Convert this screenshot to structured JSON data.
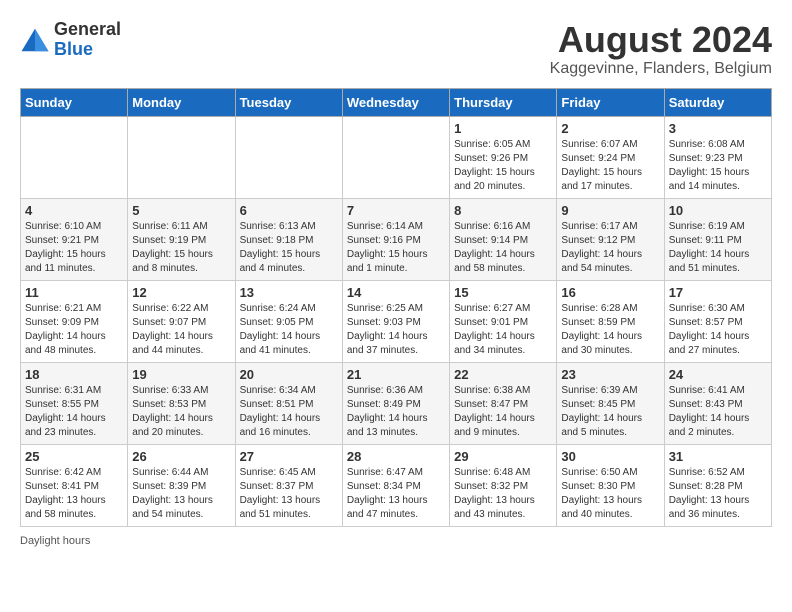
{
  "logo": {
    "general": "General",
    "blue": "Blue"
  },
  "title": "August 2024",
  "location": "Kaggevinne, Flanders, Belgium",
  "days_of_week": [
    "Sunday",
    "Monday",
    "Tuesday",
    "Wednesday",
    "Thursday",
    "Friday",
    "Saturday"
  ],
  "footer": "Daylight hours",
  "weeks": [
    [
      {
        "day": "",
        "detail": ""
      },
      {
        "day": "",
        "detail": ""
      },
      {
        "day": "",
        "detail": ""
      },
      {
        "day": "",
        "detail": ""
      },
      {
        "day": "1",
        "detail": "Sunrise: 6:05 AM\nSunset: 9:26 PM\nDaylight: 15 hours\nand 20 minutes."
      },
      {
        "day": "2",
        "detail": "Sunrise: 6:07 AM\nSunset: 9:24 PM\nDaylight: 15 hours\nand 17 minutes."
      },
      {
        "day": "3",
        "detail": "Sunrise: 6:08 AM\nSunset: 9:23 PM\nDaylight: 15 hours\nand 14 minutes."
      }
    ],
    [
      {
        "day": "4",
        "detail": "Sunrise: 6:10 AM\nSunset: 9:21 PM\nDaylight: 15 hours\nand 11 minutes."
      },
      {
        "day": "5",
        "detail": "Sunrise: 6:11 AM\nSunset: 9:19 PM\nDaylight: 15 hours\nand 8 minutes."
      },
      {
        "day": "6",
        "detail": "Sunrise: 6:13 AM\nSunset: 9:18 PM\nDaylight: 15 hours\nand 4 minutes."
      },
      {
        "day": "7",
        "detail": "Sunrise: 6:14 AM\nSunset: 9:16 PM\nDaylight: 15 hours\nand 1 minute."
      },
      {
        "day": "8",
        "detail": "Sunrise: 6:16 AM\nSunset: 9:14 PM\nDaylight: 14 hours\nand 58 minutes."
      },
      {
        "day": "9",
        "detail": "Sunrise: 6:17 AM\nSunset: 9:12 PM\nDaylight: 14 hours\nand 54 minutes."
      },
      {
        "day": "10",
        "detail": "Sunrise: 6:19 AM\nSunset: 9:11 PM\nDaylight: 14 hours\nand 51 minutes."
      }
    ],
    [
      {
        "day": "11",
        "detail": "Sunrise: 6:21 AM\nSunset: 9:09 PM\nDaylight: 14 hours\nand 48 minutes."
      },
      {
        "day": "12",
        "detail": "Sunrise: 6:22 AM\nSunset: 9:07 PM\nDaylight: 14 hours\nand 44 minutes."
      },
      {
        "day": "13",
        "detail": "Sunrise: 6:24 AM\nSunset: 9:05 PM\nDaylight: 14 hours\nand 41 minutes."
      },
      {
        "day": "14",
        "detail": "Sunrise: 6:25 AM\nSunset: 9:03 PM\nDaylight: 14 hours\nand 37 minutes."
      },
      {
        "day": "15",
        "detail": "Sunrise: 6:27 AM\nSunset: 9:01 PM\nDaylight: 14 hours\nand 34 minutes."
      },
      {
        "day": "16",
        "detail": "Sunrise: 6:28 AM\nSunset: 8:59 PM\nDaylight: 14 hours\nand 30 minutes."
      },
      {
        "day": "17",
        "detail": "Sunrise: 6:30 AM\nSunset: 8:57 PM\nDaylight: 14 hours\nand 27 minutes."
      }
    ],
    [
      {
        "day": "18",
        "detail": "Sunrise: 6:31 AM\nSunset: 8:55 PM\nDaylight: 14 hours\nand 23 minutes."
      },
      {
        "day": "19",
        "detail": "Sunrise: 6:33 AM\nSunset: 8:53 PM\nDaylight: 14 hours\nand 20 minutes."
      },
      {
        "day": "20",
        "detail": "Sunrise: 6:34 AM\nSunset: 8:51 PM\nDaylight: 14 hours\nand 16 minutes."
      },
      {
        "day": "21",
        "detail": "Sunrise: 6:36 AM\nSunset: 8:49 PM\nDaylight: 14 hours\nand 13 minutes."
      },
      {
        "day": "22",
        "detail": "Sunrise: 6:38 AM\nSunset: 8:47 PM\nDaylight: 14 hours\nand 9 minutes."
      },
      {
        "day": "23",
        "detail": "Sunrise: 6:39 AM\nSunset: 8:45 PM\nDaylight: 14 hours\nand 5 minutes."
      },
      {
        "day": "24",
        "detail": "Sunrise: 6:41 AM\nSunset: 8:43 PM\nDaylight: 14 hours\nand 2 minutes."
      }
    ],
    [
      {
        "day": "25",
        "detail": "Sunrise: 6:42 AM\nSunset: 8:41 PM\nDaylight: 13 hours\nand 58 minutes."
      },
      {
        "day": "26",
        "detail": "Sunrise: 6:44 AM\nSunset: 8:39 PM\nDaylight: 13 hours\nand 54 minutes."
      },
      {
        "day": "27",
        "detail": "Sunrise: 6:45 AM\nSunset: 8:37 PM\nDaylight: 13 hours\nand 51 minutes."
      },
      {
        "day": "28",
        "detail": "Sunrise: 6:47 AM\nSunset: 8:34 PM\nDaylight: 13 hours\nand 47 minutes."
      },
      {
        "day": "29",
        "detail": "Sunrise: 6:48 AM\nSunset: 8:32 PM\nDaylight: 13 hours\nand 43 minutes."
      },
      {
        "day": "30",
        "detail": "Sunrise: 6:50 AM\nSunset: 8:30 PM\nDaylight: 13 hours\nand 40 minutes."
      },
      {
        "day": "31",
        "detail": "Sunrise: 6:52 AM\nSunset: 8:28 PM\nDaylight: 13 hours\nand 36 minutes."
      }
    ]
  ]
}
